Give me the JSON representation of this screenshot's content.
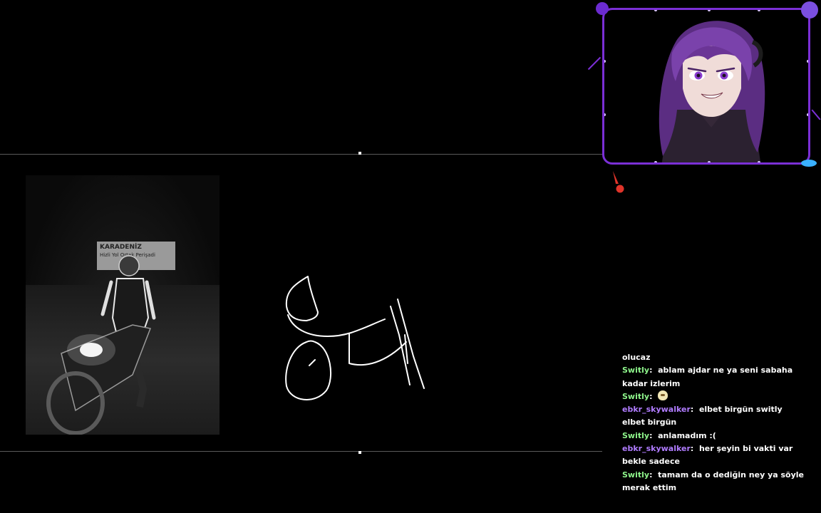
{
  "stream": {
    "chat": [
      {
        "user": "",
        "text": "olucaz",
        "color": "#ffffff"
      },
      {
        "user": "Switly",
        "text": "ablam ajdar ne ya seni sabaha kadar izlerim",
        "color": "#8ef58b"
      },
      {
        "user": "Switly",
        "text": "",
        "emote": "blob-emote",
        "color": "#8ef58b"
      },
      {
        "user": "ebkr_skywalker",
        "text": "elbet birgün switly elbet birgün",
        "color": "#b07cff"
      },
      {
        "user": "Switly",
        "text": "anlamadım :(",
        "color": "#8ef58b"
      },
      {
        "user": "ebkr_skywalker",
        "text": "her şeyin bi vakti var bekle sadece",
        "color": "#b07cff"
      },
      {
        "user": "Switly",
        "text": "tamam da o dediğin ney ya söyle merak ettim",
        "color": "#8ef58b"
      }
    ],
    "photo": {
      "sign_line1": "KARADENİZ",
      "sign_line2": "Hizli Yol Ortak Perişadi"
    },
    "colors": {
      "frame": "#7b2fd6",
      "switly": "#8ef58b",
      "ebkr": "#b07cff"
    }
  }
}
